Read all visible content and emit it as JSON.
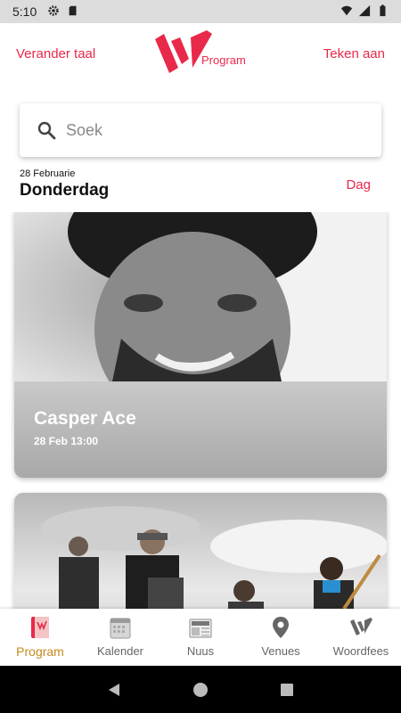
{
  "status_bar": {
    "time": "5:10",
    "icons": [
      "gear-icon",
      "sd-card-icon",
      "wifi-icon",
      "signal-icon",
      "battery-icon"
    ]
  },
  "header": {
    "language_link": "Verander taal",
    "logo_text": "Program",
    "signin_link": "Teken aan",
    "accent_color": "#e8294a"
  },
  "search": {
    "placeholder": "Soek",
    "value": ""
  },
  "date_section": {
    "date": "28 Februarie",
    "weekday": "Donderdag",
    "view_toggle": "Dag"
  },
  "events": [
    {
      "name": "Casper Ace",
      "time": "28 Feb 13:00"
    },
    {
      "name": "",
      "time": ""
    }
  ],
  "tabs": [
    {
      "label": "Program",
      "icon": "program-icon",
      "active": true
    },
    {
      "label": "Kalender",
      "icon": "calendar-icon",
      "active": false
    },
    {
      "label": "Nuus",
      "icon": "news-icon",
      "active": false
    },
    {
      "label": "Venues",
      "icon": "location-pin-icon",
      "active": false
    },
    {
      "label": "Woordfees",
      "icon": "woordfees-logo-icon",
      "active": false
    }
  ],
  "nav": [
    "back-icon",
    "home-icon",
    "recents-icon"
  ],
  "colors": {
    "accent": "#e8294a",
    "active_tab": "#c48a1c",
    "status_bar": "#dcdcdc"
  }
}
